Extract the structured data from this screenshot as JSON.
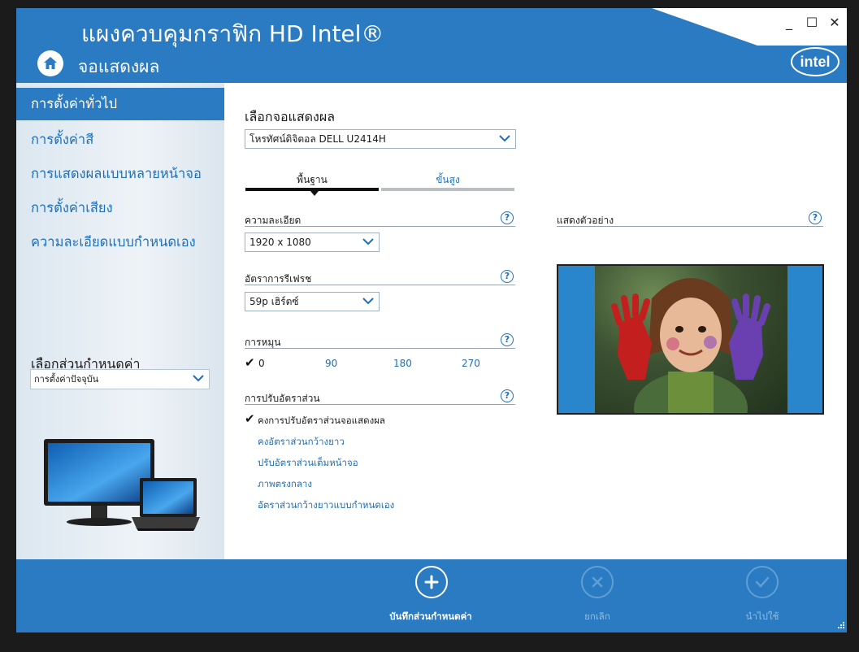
{
  "window": {
    "title": "แผงควบคุมกราฟิก HD Intel®",
    "page": "จอแสดงผล",
    "logo_text": "intel",
    "controls": {
      "minimize": "_",
      "maximize": "☐",
      "close": "✕"
    }
  },
  "sidebar": {
    "items": [
      {
        "label": "การตั้งค่าทั่วไป",
        "active": true
      },
      {
        "label": "การตั้งค่าสี",
        "active": false
      },
      {
        "label": "การแสดงผลแบบหลายหน้าจอ",
        "active": false
      },
      {
        "label": "การตั้งค่าเสียง",
        "active": false
      },
      {
        "label": "ความละเอียดแบบกำหนดเอง",
        "active": false
      }
    ],
    "profile": {
      "label": "เลือกส่วนกำหนดค่า",
      "selected": "การตั้งค่าปัจจุบัน"
    }
  },
  "main": {
    "display_select": {
      "label": "เลือกจอแสดงผล",
      "selected": "โหรทัศน์ดิจิตอล DELL U2414H"
    },
    "tabs": [
      {
        "label": "พื้นฐาน",
        "active": true
      },
      {
        "label": "ขั้นสูง",
        "active": false
      }
    ],
    "resolution": {
      "label": "ความละเอียด",
      "selected": "1920 x 1080"
    },
    "refresh": {
      "label": "อัตราการรีเฟรช",
      "selected": "59p เฮิร์ตซ์"
    },
    "rotation": {
      "label": "การหมุน",
      "options": [
        "0",
        "90",
        "180",
        "270"
      ],
      "selected": "0"
    },
    "scaling": {
      "label": "การปรับอัตราส่วน",
      "options": [
        "คงการปรับอัตราส่วนจอแสดงผล",
        "คงอัตราส่วนกว้างยาว",
        "ปรับอัตราส่วนเต็มหน้าจอ",
        "ภาพตรงกลาง",
        "อัตราส่วนกว้างยาวแบบกำหนดเอง"
      ],
      "selected": "คงการปรับอัตราส่วนจอแสดงผล"
    },
    "preview": {
      "label": "แสดงตัวอย่าง"
    },
    "help_glyph": "?"
  },
  "footer": {
    "save_profile": "บันทึกส่วนกำหนดค่า",
    "cancel": "ยกเลิก",
    "apply": "นำไปใช้"
  },
  "colors": {
    "accent": "#2a7bc2",
    "link": "#1e6fb8",
    "sidebar_bg": "#e3ecf3"
  }
}
